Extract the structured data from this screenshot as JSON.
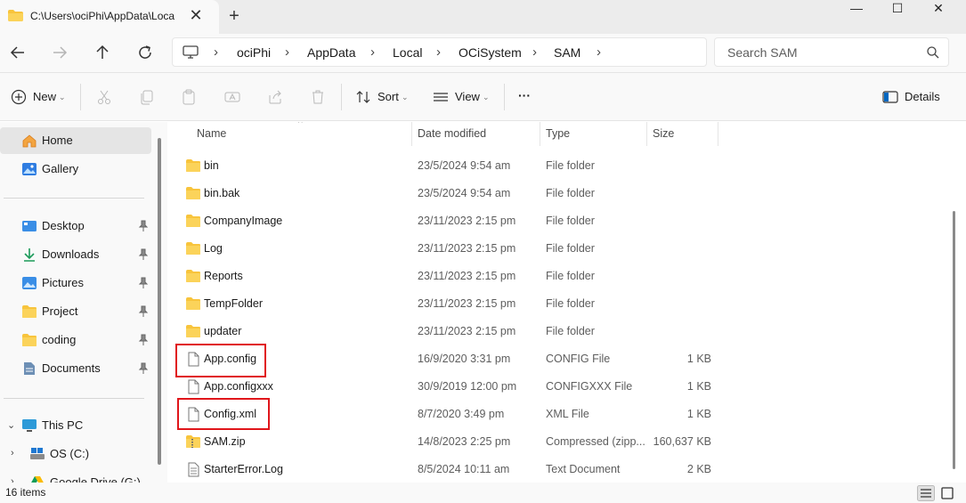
{
  "window": {
    "tab_title": "C:\\Users\\ociPhi\\AppData\\Loca",
    "tab_close": "✕",
    "new_tab": "+",
    "minimize": "—",
    "maximize": "☐",
    "close": "✕"
  },
  "address": {
    "crumbs": [
      "ociPhi",
      "AppData",
      "Local",
      "OCiSystem",
      "SAM"
    ],
    "separator": "›"
  },
  "search": {
    "placeholder": "Search SAM"
  },
  "toolbar": {
    "new_label": "New",
    "sort_label": "Sort",
    "view_label": "View",
    "more_label": "···",
    "details_label": "Details"
  },
  "sidebar": {
    "home": "Home",
    "gallery": "Gallery",
    "quick": [
      "Desktop",
      "Downloads",
      "Pictures",
      "Project",
      "coding",
      "Documents"
    ],
    "this_pc": "This PC",
    "os_c": "OS (C:)",
    "google_drive": "Google Drive (G:)"
  },
  "columns": {
    "name": "Name",
    "date": "Date modified",
    "type": "Type",
    "size": "Size"
  },
  "files": [
    {
      "name": "bin",
      "date": "23/5/2024 9:54 am",
      "type": "File folder",
      "size": "",
      "icon": "folder-icon"
    },
    {
      "name": "bin.bak",
      "date": "23/5/2024 9:54 am",
      "type": "File folder",
      "size": "",
      "icon": "folder-icon"
    },
    {
      "name": "CompanyImage",
      "date": "23/11/2023 2:15 pm",
      "type": "File folder",
      "size": "",
      "icon": "folder-icon"
    },
    {
      "name": "Log",
      "date": "23/11/2023 2:15 pm",
      "type": "File folder",
      "size": "",
      "icon": "folder-icon"
    },
    {
      "name": "Reports",
      "date": "23/11/2023 2:15 pm",
      "type": "File folder",
      "size": "",
      "icon": "folder-icon"
    },
    {
      "name": "TempFolder",
      "date": "23/11/2023 2:15 pm",
      "type": "File folder",
      "size": "",
      "icon": "folder-icon"
    },
    {
      "name": "updater",
      "date": "23/11/2023 2:15 pm",
      "type": "File folder",
      "size": "",
      "icon": "folder-icon"
    },
    {
      "name": "App.config",
      "date": "16/9/2020 3:31 pm",
      "type": "CONFIG File",
      "size": "1 KB",
      "icon": "file-icon"
    },
    {
      "name": "App.configxxx",
      "date": "30/9/2019 12:00 pm",
      "type": "CONFIGXXX File",
      "size": "1 KB",
      "icon": "file-icon"
    },
    {
      "name": "Config.xml",
      "date": "8/7/2020 3:49 pm",
      "type": "XML File",
      "size": "1 KB",
      "icon": "file-icon"
    },
    {
      "name": "SAM.zip",
      "date": "14/8/2023 2:25 pm",
      "type": "Compressed (zipp...",
      "size": "160,637 KB",
      "icon": "zip-folder-icon"
    },
    {
      "name": "StarterError.Log",
      "date": "8/5/2024 10:11 am",
      "type": "Text Document",
      "size": "2 KB",
      "icon": "text-file-icon"
    }
  ],
  "status": {
    "item_count": "16 items"
  },
  "colors": {
    "highlight": "#e0161b",
    "folder": "#f8c43c",
    "accent": "#0067c0"
  }
}
